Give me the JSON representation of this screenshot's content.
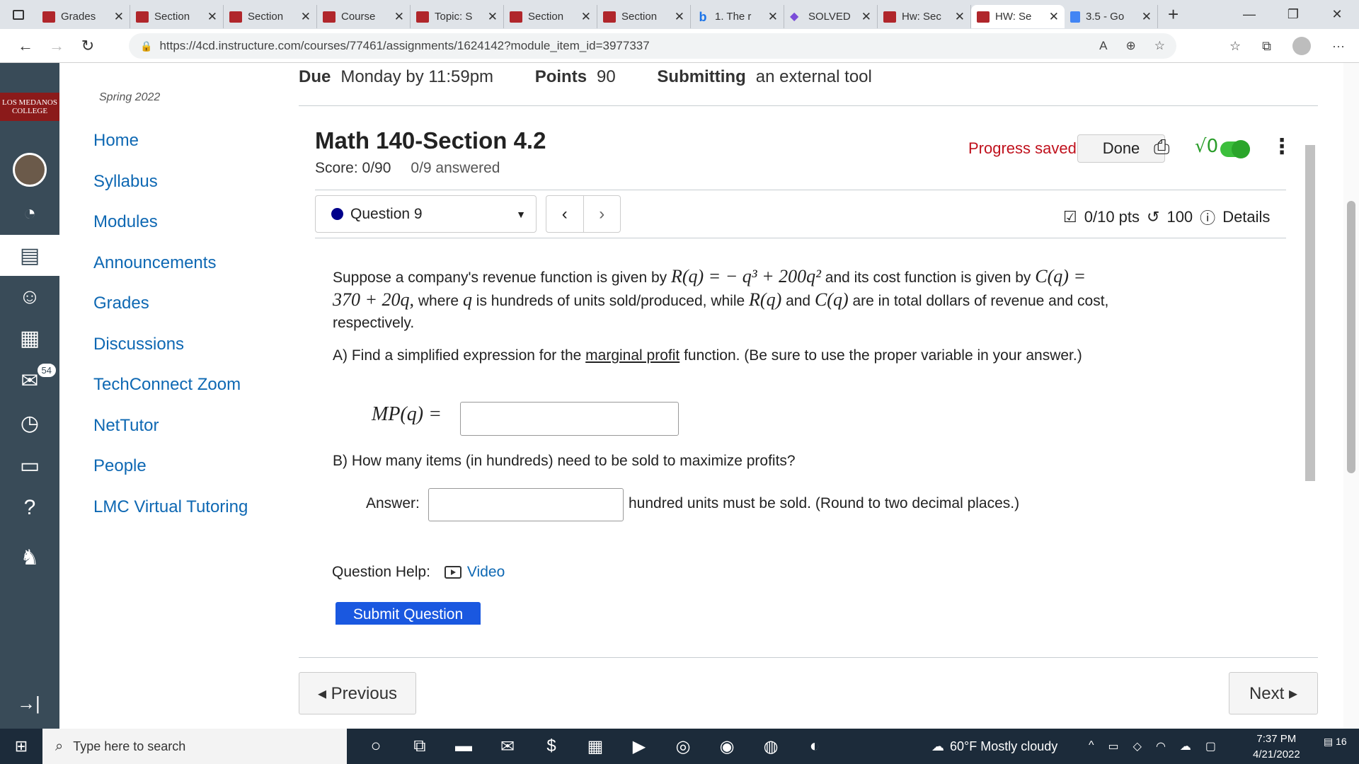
{
  "browser": {
    "tabs": [
      {
        "label": "Grades",
        "icon": "canvas-favicon"
      },
      {
        "label": "Section",
        "icon": "canvas-favicon"
      },
      {
        "label": "Section",
        "icon": "canvas-favicon"
      },
      {
        "label": "Course",
        "icon": "canvas-favicon"
      },
      {
        "label": "Topic: S",
        "icon": "canvas-favicon"
      },
      {
        "label": "Section",
        "icon": "canvas-favicon"
      },
      {
        "label": "Section",
        "icon": "canvas-favicon"
      },
      {
        "label": "1. The r",
        "icon": "bing-favicon"
      },
      {
        "label": "SOLVED",
        "icon": "solved-favicon"
      },
      {
        "label": "Hw: Sec",
        "icon": "canvas-favicon"
      },
      {
        "label": "HW: Se",
        "icon": "canvas-favicon",
        "active": true
      },
      {
        "label": "3.5 - Go",
        "icon": "docs-favicon"
      }
    ],
    "url": "https://4cd.instructure.com/courses/77461/assignments/1624142?module_item_id=3977337"
  },
  "global_nav": {
    "logo_text": "LOS MEDANOS COLLEGE",
    "inbox_badge": "54"
  },
  "course_nav": {
    "term": "Spring 2022",
    "items": [
      "Home",
      "Syllabus",
      "Modules",
      "Announcements",
      "Grades",
      "Discussions",
      "TechConnect Zoom",
      "NetTutor",
      "People",
      "LMC Virtual Tutoring"
    ]
  },
  "assignment": {
    "due_label": "Due",
    "due_value": "Monday by 11:59pm",
    "points_label": "Points",
    "points_value": "90",
    "submitting_label": "Submitting",
    "submitting_value": "an external tool"
  },
  "quiz": {
    "title": "Math 140-Section 4.2",
    "score": "Score: 0/90",
    "answered": "0/9 answered",
    "progress": "Progress saved",
    "done": "Done",
    "question_select": "Question 9",
    "pts": "0/10 pts",
    "attempts": "100",
    "details": "Details",
    "help_label": "Question Help:",
    "video_label": "Video",
    "submit_label": "Submit Question"
  },
  "question": {
    "intro_1": "Suppose a company's revenue function is given by",
    "revenue_fn": "R(q) = − q³ + 200q²",
    "intro_2": "and its cost function is given by",
    "cost_fn": "C(q) = 370 + 20q,",
    "intro_3": "where",
    "var": "q",
    "intro_4": "is hundreds of units sold/produced, while",
    "rq": "R(q)",
    "and": "and",
    "cq": "C(q)",
    "intro_5": "are in total dollars of revenue and cost, respectively.",
    "part_a_1": "A) Find a simplified expression for the",
    "part_a_link": "marginal profit",
    "part_a_2": "function. (Be sure to use the proper variable in your answer.)",
    "mp_label": "MP(q) =",
    "part_b": "B) How many items (in hundreds) need to be sold to maximize profits?",
    "answer_label": "Answer:",
    "answer_suffix": "hundred units must be sold. (Round to two decimal places.)"
  },
  "pager": {
    "previous": "◂ Previous",
    "next": "Next ▸"
  },
  "taskbar": {
    "search_placeholder": "Type here to search",
    "weather": "60°F  Mostly cloudy",
    "time": "7:37 PM",
    "date": "4/21/2022",
    "notifications": "16"
  }
}
